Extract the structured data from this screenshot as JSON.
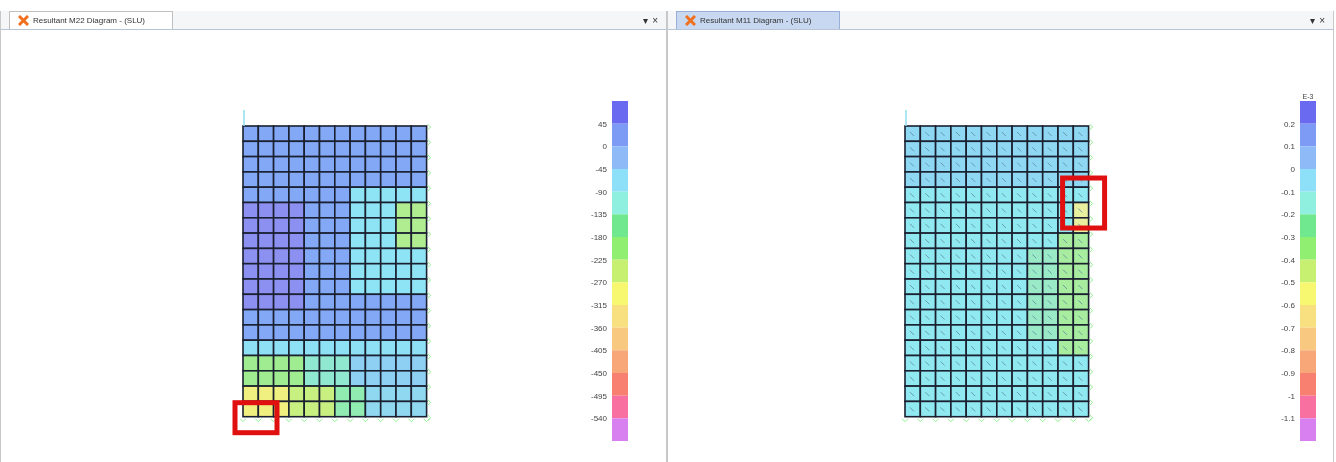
{
  "panes": [
    {
      "kind": "m22",
      "tab": {
        "label": "Resultant M22 Diagram - (SLU)",
        "selected": false
      },
      "header_buttons": [
        "▾",
        "×"
      ],
      "legend": {
        "labels": [
          "45",
          "0",
          "-45",
          "-90",
          "-135",
          "-180",
          "-225",
          "-270",
          "-315",
          "-360",
          "-405",
          "-450",
          "-495",
          "-540"
        ]
      }
    },
    {
      "kind": "m11",
      "tab": {
        "label": "Resultant M11 Diagram - (SLU)",
        "selected": true
      },
      "header_buttons": [
        "▾",
        "×"
      ],
      "legend": {
        "unit": "E-3",
        "labels": [
          "0.2",
          "0.1",
          "0",
          "-0.1",
          "-0.2",
          "-0.3",
          "-0.4",
          "-0.5",
          "-0.6",
          "-0.7",
          "-0.8",
          "-0.9",
          "-1",
          "-1.1"
        ]
      }
    }
  ]
}
